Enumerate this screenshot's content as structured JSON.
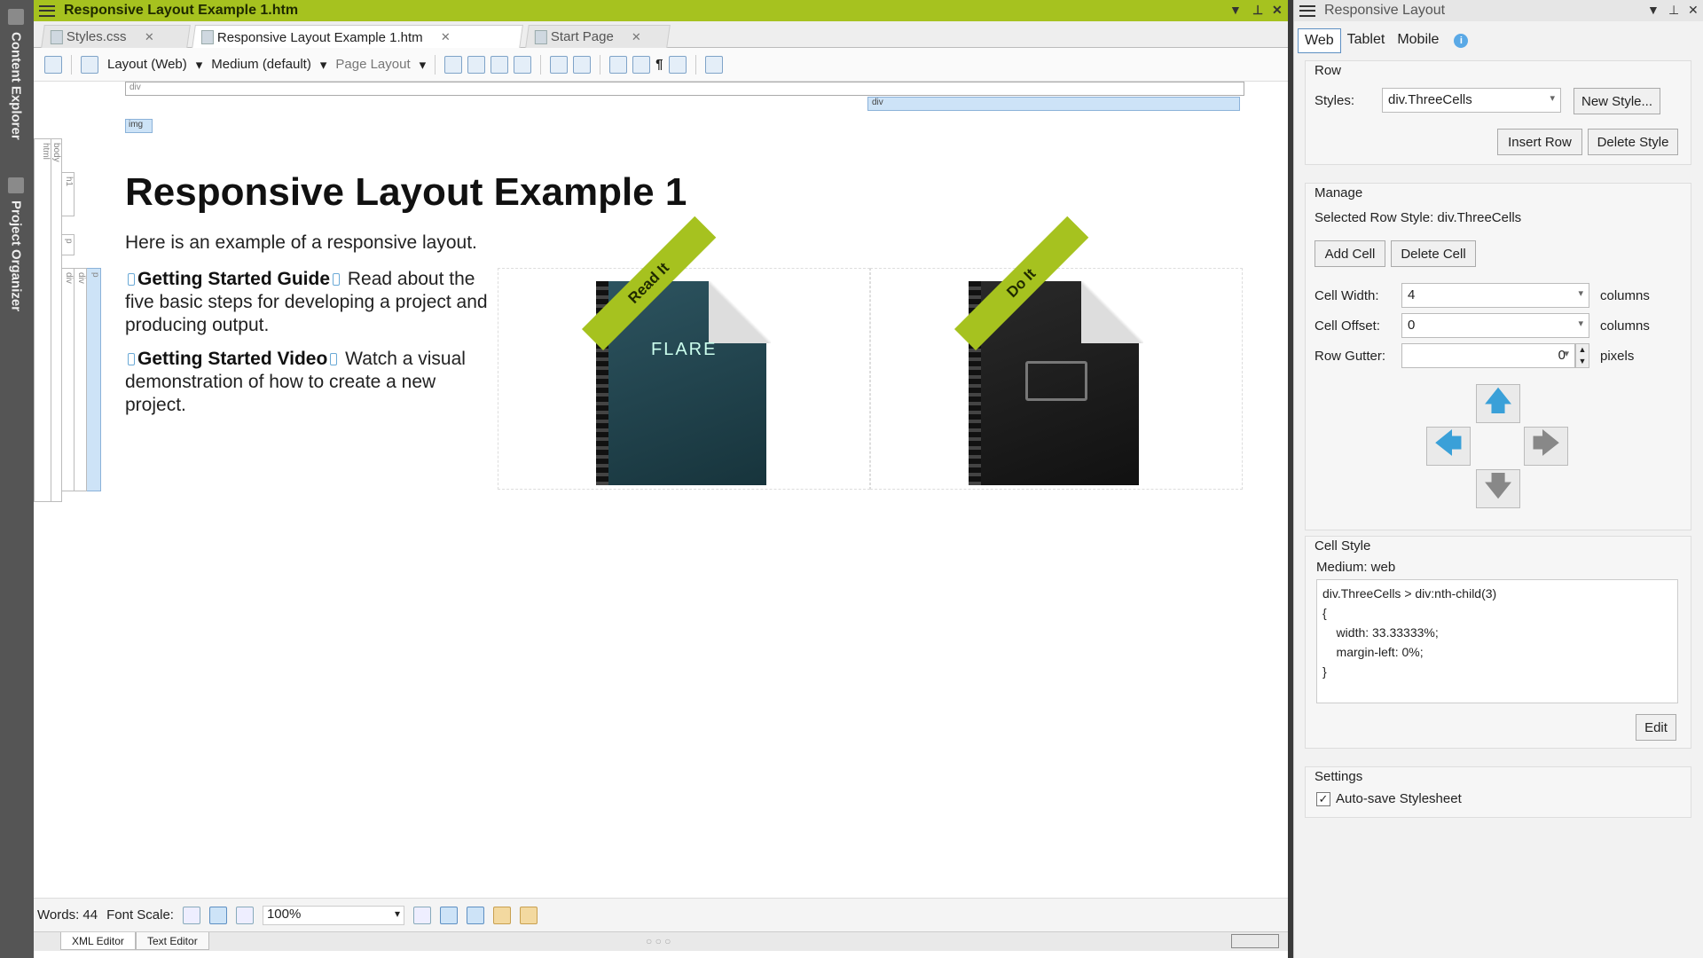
{
  "left_sidebar": {
    "items": [
      "Content Explorer",
      "Project Organizer"
    ]
  },
  "document": {
    "title": "Responsive Layout Example 1.htm",
    "tabs": [
      {
        "label": "Styles.css",
        "active": false
      },
      {
        "label": "Responsive Layout Example 1.htm",
        "active": true
      },
      {
        "label": "Start Page",
        "active": false
      }
    ],
    "toolbar": {
      "layout": "Layout (Web)",
      "medium": "Medium (default)",
      "page_layout": "Page Layout"
    },
    "tags": {
      "ruler": "div",
      "div": "div",
      "img": "img",
      "html": "html",
      "body": "body",
      "h1": "h1",
      "p": "p",
      "div1": "div",
      "div2": "div",
      "p2": "p"
    },
    "content": {
      "heading": "Responsive Layout Example 1",
      "intro": "Here is an example of a responsive layout.",
      "para1_bold": "Getting Started Guide",
      "para1_text": "Read about the five basic steps for developing a project and producing output.",
      "para2_bold": "Getting Started Video",
      "para2_text": "Watch a visual demonstration of how to create a new project.",
      "book1_ribbon": "Read It",
      "book1_title": "FLARE",
      "book2_ribbon": "Do It"
    },
    "status": {
      "words": "Words: 44",
      "font_scale": "Font Scale:",
      "zoom": "100%"
    },
    "bottom_tabs": [
      "XML Editor",
      "Text Editor"
    ]
  },
  "panel": {
    "title": "Responsive Layout",
    "tabs": [
      "Web",
      "Tablet",
      "Mobile"
    ],
    "row": {
      "header": "Row",
      "styles_label": "Styles:",
      "styles_value": "div.ThreeCells",
      "new_style": "New Style...",
      "insert_row": "Insert Row",
      "delete_style": "Delete Style"
    },
    "manage": {
      "header": "Manage",
      "selected": "Selected Row Style: div.ThreeCells",
      "add_cell": "Add Cell",
      "delete_cell": "Delete Cell",
      "cell_width_label": "Cell Width:",
      "cell_width": "4",
      "cell_offset_label": "Cell Offset:",
      "cell_offset": "0",
      "row_gutter_label": "Row Gutter:",
      "row_gutter": "0",
      "columns": "columns",
      "pixels": "pixels"
    },
    "cell_style": {
      "header": "Cell Style",
      "medium": "Medium: web",
      "css": "div.ThreeCells > div:nth-child(3)\n{\n    width: 33.33333%;\n    margin-left: 0%;\n}",
      "edit": "Edit"
    },
    "settings": {
      "header": "Settings",
      "autosave": "Auto-save Stylesheet",
      "autosave_checked": true
    }
  },
  "colors": {
    "accent": "#a6c21f",
    "arrow_up": "#3aa0d8",
    "arrow_gray": "#888888",
    "selection": "#cde3f7"
  }
}
